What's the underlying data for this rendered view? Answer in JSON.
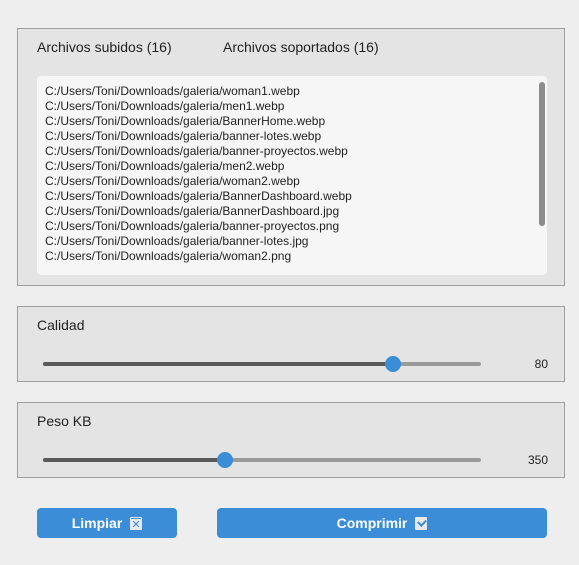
{
  "files_panel": {
    "tab_uploaded": "Archivos subidos (16)",
    "tab_supported": "Archivos soportados (16)",
    "files": [
      "C:/Users/Toni/Downloads/galeria/woman1.webp",
      "C:/Users/Toni/Downloads/galeria/men1.webp",
      "C:/Users/Toni/Downloads/galeria/BannerHome.webp",
      "C:/Users/Toni/Downloads/galeria/banner-lotes.webp",
      "C:/Users/Toni/Downloads/galeria/banner-proyectos.webp",
      "C:/Users/Toni/Downloads/galeria/men2.webp",
      "C:/Users/Toni/Downloads/galeria/woman2.webp",
      "C:/Users/Toni/Downloads/galeria/BannerDashboard.webp",
      "C:/Users/Toni/Downloads/galeria/BannerDashboard.jpg",
      "C:/Users/Toni/Downloads/galeria/banner-proyectos.png",
      "C:/Users/Toni/Downloads/galeria/banner-lotes.jpg",
      "C:/Users/Toni/Downloads/galeria/woman2.png"
    ]
  },
  "quality": {
    "label": "Calidad",
    "value": "80",
    "level": 0.8
  },
  "weight": {
    "label": "Peso KB",
    "value": "350",
    "level": 0.416
  },
  "buttons": {
    "clear_label": "Limpiar",
    "compress_label": "Comprimir"
  },
  "icons": {
    "clear": "trash-icon",
    "compress": "checkbox-icon"
  },
  "colors": {
    "accent": "#3a8dd6",
    "track": "#9a9a9a",
    "track_fill": "#5a5a5a"
  }
}
